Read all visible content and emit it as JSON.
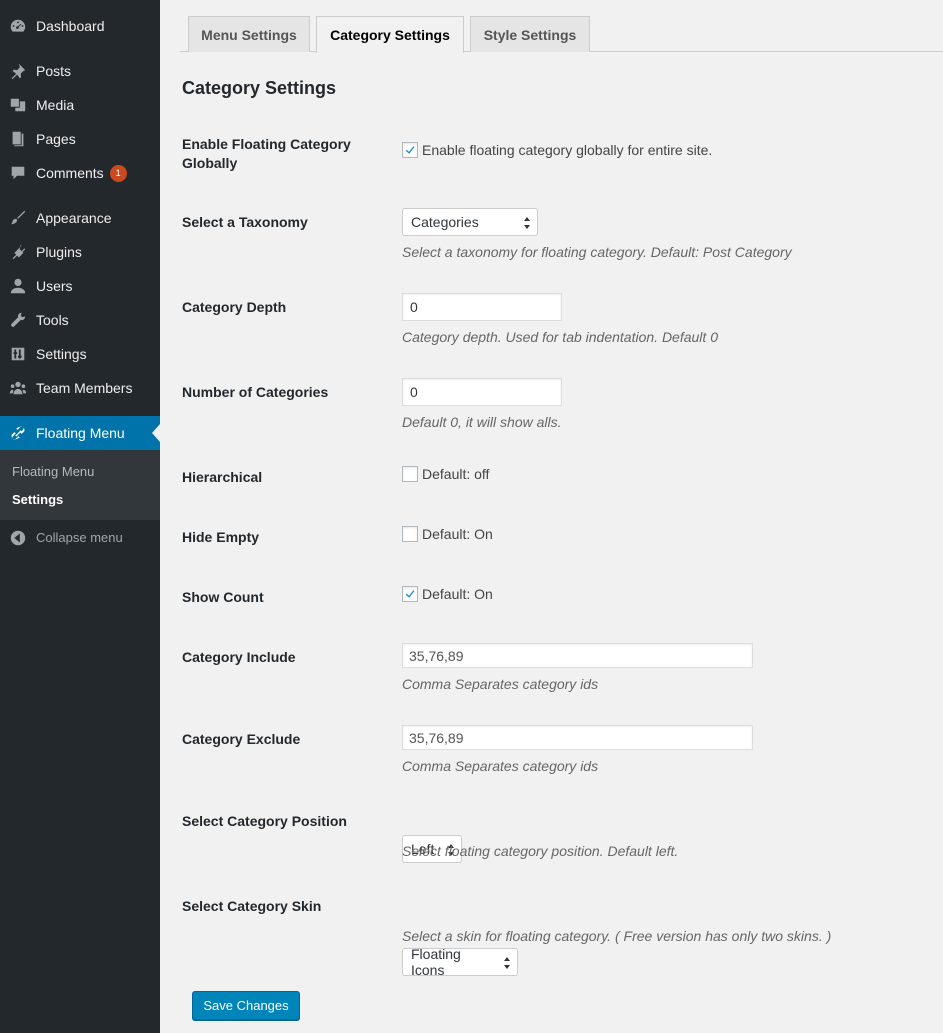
{
  "sidebar": {
    "items": [
      {
        "label": "Dashboard",
        "icon": "dashboard-icon"
      },
      {
        "label": "Posts",
        "icon": "pin-icon"
      },
      {
        "label": "Media",
        "icon": "media-icon"
      },
      {
        "label": "Pages",
        "icon": "pages-icon"
      },
      {
        "label": "Comments",
        "icon": "comment-icon",
        "badge": "1"
      },
      {
        "label": "Appearance",
        "icon": "brush-icon"
      },
      {
        "label": "Plugins",
        "icon": "plug-icon"
      },
      {
        "label": "Users",
        "icon": "user-icon"
      },
      {
        "label": "Tools",
        "icon": "wrench-icon"
      },
      {
        "label": "Settings",
        "icon": "sliders-icon"
      },
      {
        "label": "Team Members",
        "icon": "group-icon"
      },
      {
        "label": "Floating Menu",
        "icon": "link-icon"
      }
    ],
    "submenu": [
      "Floating Menu",
      "Settings"
    ],
    "collapse": "Collapse menu"
  },
  "tabs": [
    "Menu Settings",
    "Category Settings",
    "Style Settings"
  ],
  "page_title": "Category Settings",
  "rows": {
    "enable": {
      "label": "Enable Floating Category Globally",
      "text": "Enable floating category globally for entire site.",
      "checked": true
    },
    "taxonomy": {
      "label": "Select a Taxonomy",
      "value": "Categories",
      "desc": "Select a taxonomy for floating category. Default: Post Category"
    },
    "depth": {
      "label": "Category Depth",
      "value": "0",
      "desc": "Category depth. Used for tab indentation. Default 0"
    },
    "number": {
      "label": "Number of Categories",
      "value": "0",
      "desc": "Default 0, it will show alls."
    },
    "hierarchical": {
      "label": "Hierarchical",
      "text": "Default: off",
      "checked": false
    },
    "hide_empty": {
      "label": "Hide Empty",
      "text": "Default: On",
      "checked": false
    },
    "show_count": {
      "label": "Show Count",
      "text": "Default: On",
      "checked": true
    },
    "include": {
      "label": "Category Include",
      "value": "35,76,89",
      "desc": "Comma Separates category ids"
    },
    "exclude": {
      "label": "Category Exclude",
      "value": "35,76,89",
      "desc": "Comma Separates category ids"
    },
    "position": {
      "label": "Select Category Position",
      "value": "Left",
      "desc": "Select floating category position. Default left."
    },
    "skin": {
      "label": "Select Category Skin",
      "value": "Floating Icons",
      "desc": "Select a skin for floating category. ( Free version has only two skins. )"
    }
  },
  "save_label": "Save Changes",
  "colors": {
    "sidebar": "#23282d",
    "accent": "#0073aa",
    "button": "#0085ba",
    "badge": "#ca4a1f"
  }
}
